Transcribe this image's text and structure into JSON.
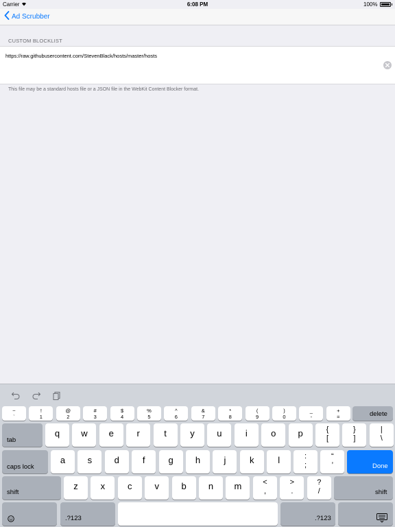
{
  "status_bar": {
    "carrier": "Carrier",
    "time": "6:08 PM",
    "battery": "100%"
  },
  "nav": {
    "back_label": "Ad Scrubber"
  },
  "section": {
    "header": "CUSTOM BLOCKLIST"
  },
  "blocklist_field": {
    "value": "https://raw.githubusercontent.com/StevenBlack/hosts/master/hosts"
  },
  "footer": {
    "note": "This file may be a standard hosts file or a JSON file in the WebKit Content Blocker format."
  },
  "colors": {
    "accent": "#0a7aff",
    "background": "#efeff4",
    "keyboard": "#d1d5db"
  },
  "keyboard": {
    "assist_icons": [
      "undo-icon",
      "redo-icon",
      "paste-icon"
    ],
    "row1": [
      {
        "top": "~",
        "bot": "`"
      },
      {
        "top": "!",
        "bot": "1"
      },
      {
        "top": "@",
        "bot": "2"
      },
      {
        "top": "#",
        "bot": "3"
      },
      {
        "top": "$",
        "bot": "4"
      },
      {
        "top": "%",
        "bot": "5"
      },
      {
        "top": "^",
        "bot": "6"
      },
      {
        "top": "&",
        "bot": "7"
      },
      {
        "top": "*",
        "bot": "8"
      },
      {
        "top": "(",
        "bot": "9"
      },
      {
        "top": ")",
        "bot": "0"
      },
      {
        "top": "_",
        "bot": "-"
      },
      {
        "top": "+",
        "bot": "="
      }
    ],
    "delete_label": "delete",
    "tab_label": "tab",
    "row2": [
      "q",
      "w",
      "e",
      "r",
      "t",
      "y",
      "u",
      "i",
      "o",
      "p"
    ],
    "row2_sym": [
      {
        "top": "{",
        "bot": "["
      },
      {
        "top": "}",
        "bot": "]"
      },
      {
        "top": "|",
        "bot": "\\"
      }
    ],
    "caps_label": "caps lock",
    "row3": [
      "a",
      "s",
      "d",
      "f",
      "g",
      "h",
      "j",
      "k",
      "l"
    ],
    "row3_sym": [
      {
        "top": ":",
        "bot": ";"
      },
      {
        "top": "“",
        "bot": "’"
      }
    ],
    "done_label": "Done",
    "shift_label": "shift",
    "row4": [
      "z",
      "x",
      "c",
      "v",
      "b",
      "n",
      "m"
    ],
    "row4_sym": [
      {
        "top": "<",
        "bot": ","
      },
      {
        "top": ">",
        "bot": "."
      },
      {
        "top": "?",
        "bot": "/"
      }
    ],
    "numbers_label": ".?123",
    "emoji_icon": "emoji-icon",
    "dismiss_icon": "keyboard-dismiss-icon"
  }
}
